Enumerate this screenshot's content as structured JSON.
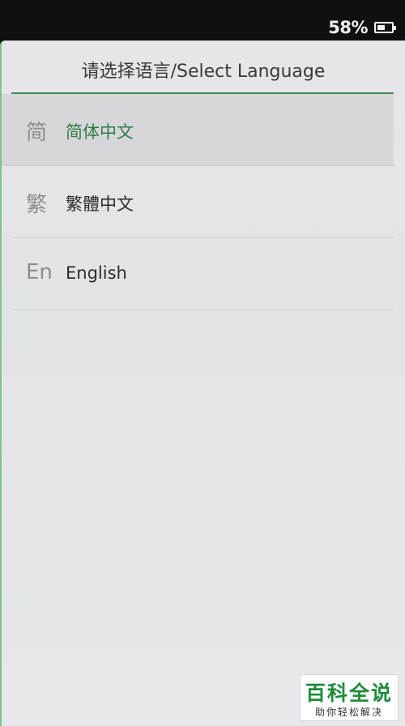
{
  "status_bar": {
    "battery_percent": "58%",
    "battery_level": 0.58,
    "battery_icon": "battery-icon"
  },
  "header": {
    "title": "请选择语言/Select Language"
  },
  "languages": [
    {
      "icon_text": "简",
      "label": "简体中文",
      "selected": true
    },
    {
      "icon_text": "繁",
      "label": "繁體中文",
      "selected": false
    },
    {
      "icon_text": "En",
      "label": "English",
      "selected": false
    }
  ],
  "watermark": {
    "title": "百科全说",
    "subtitle": "助你轻松解决"
  },
  "colors": {
    "accent": "#2f7d45",
    "divider": "#3d8a4f",
    "selected_bg": "#d7d6da",
    "watermark_green": "#1f8b3a"
  }
}
